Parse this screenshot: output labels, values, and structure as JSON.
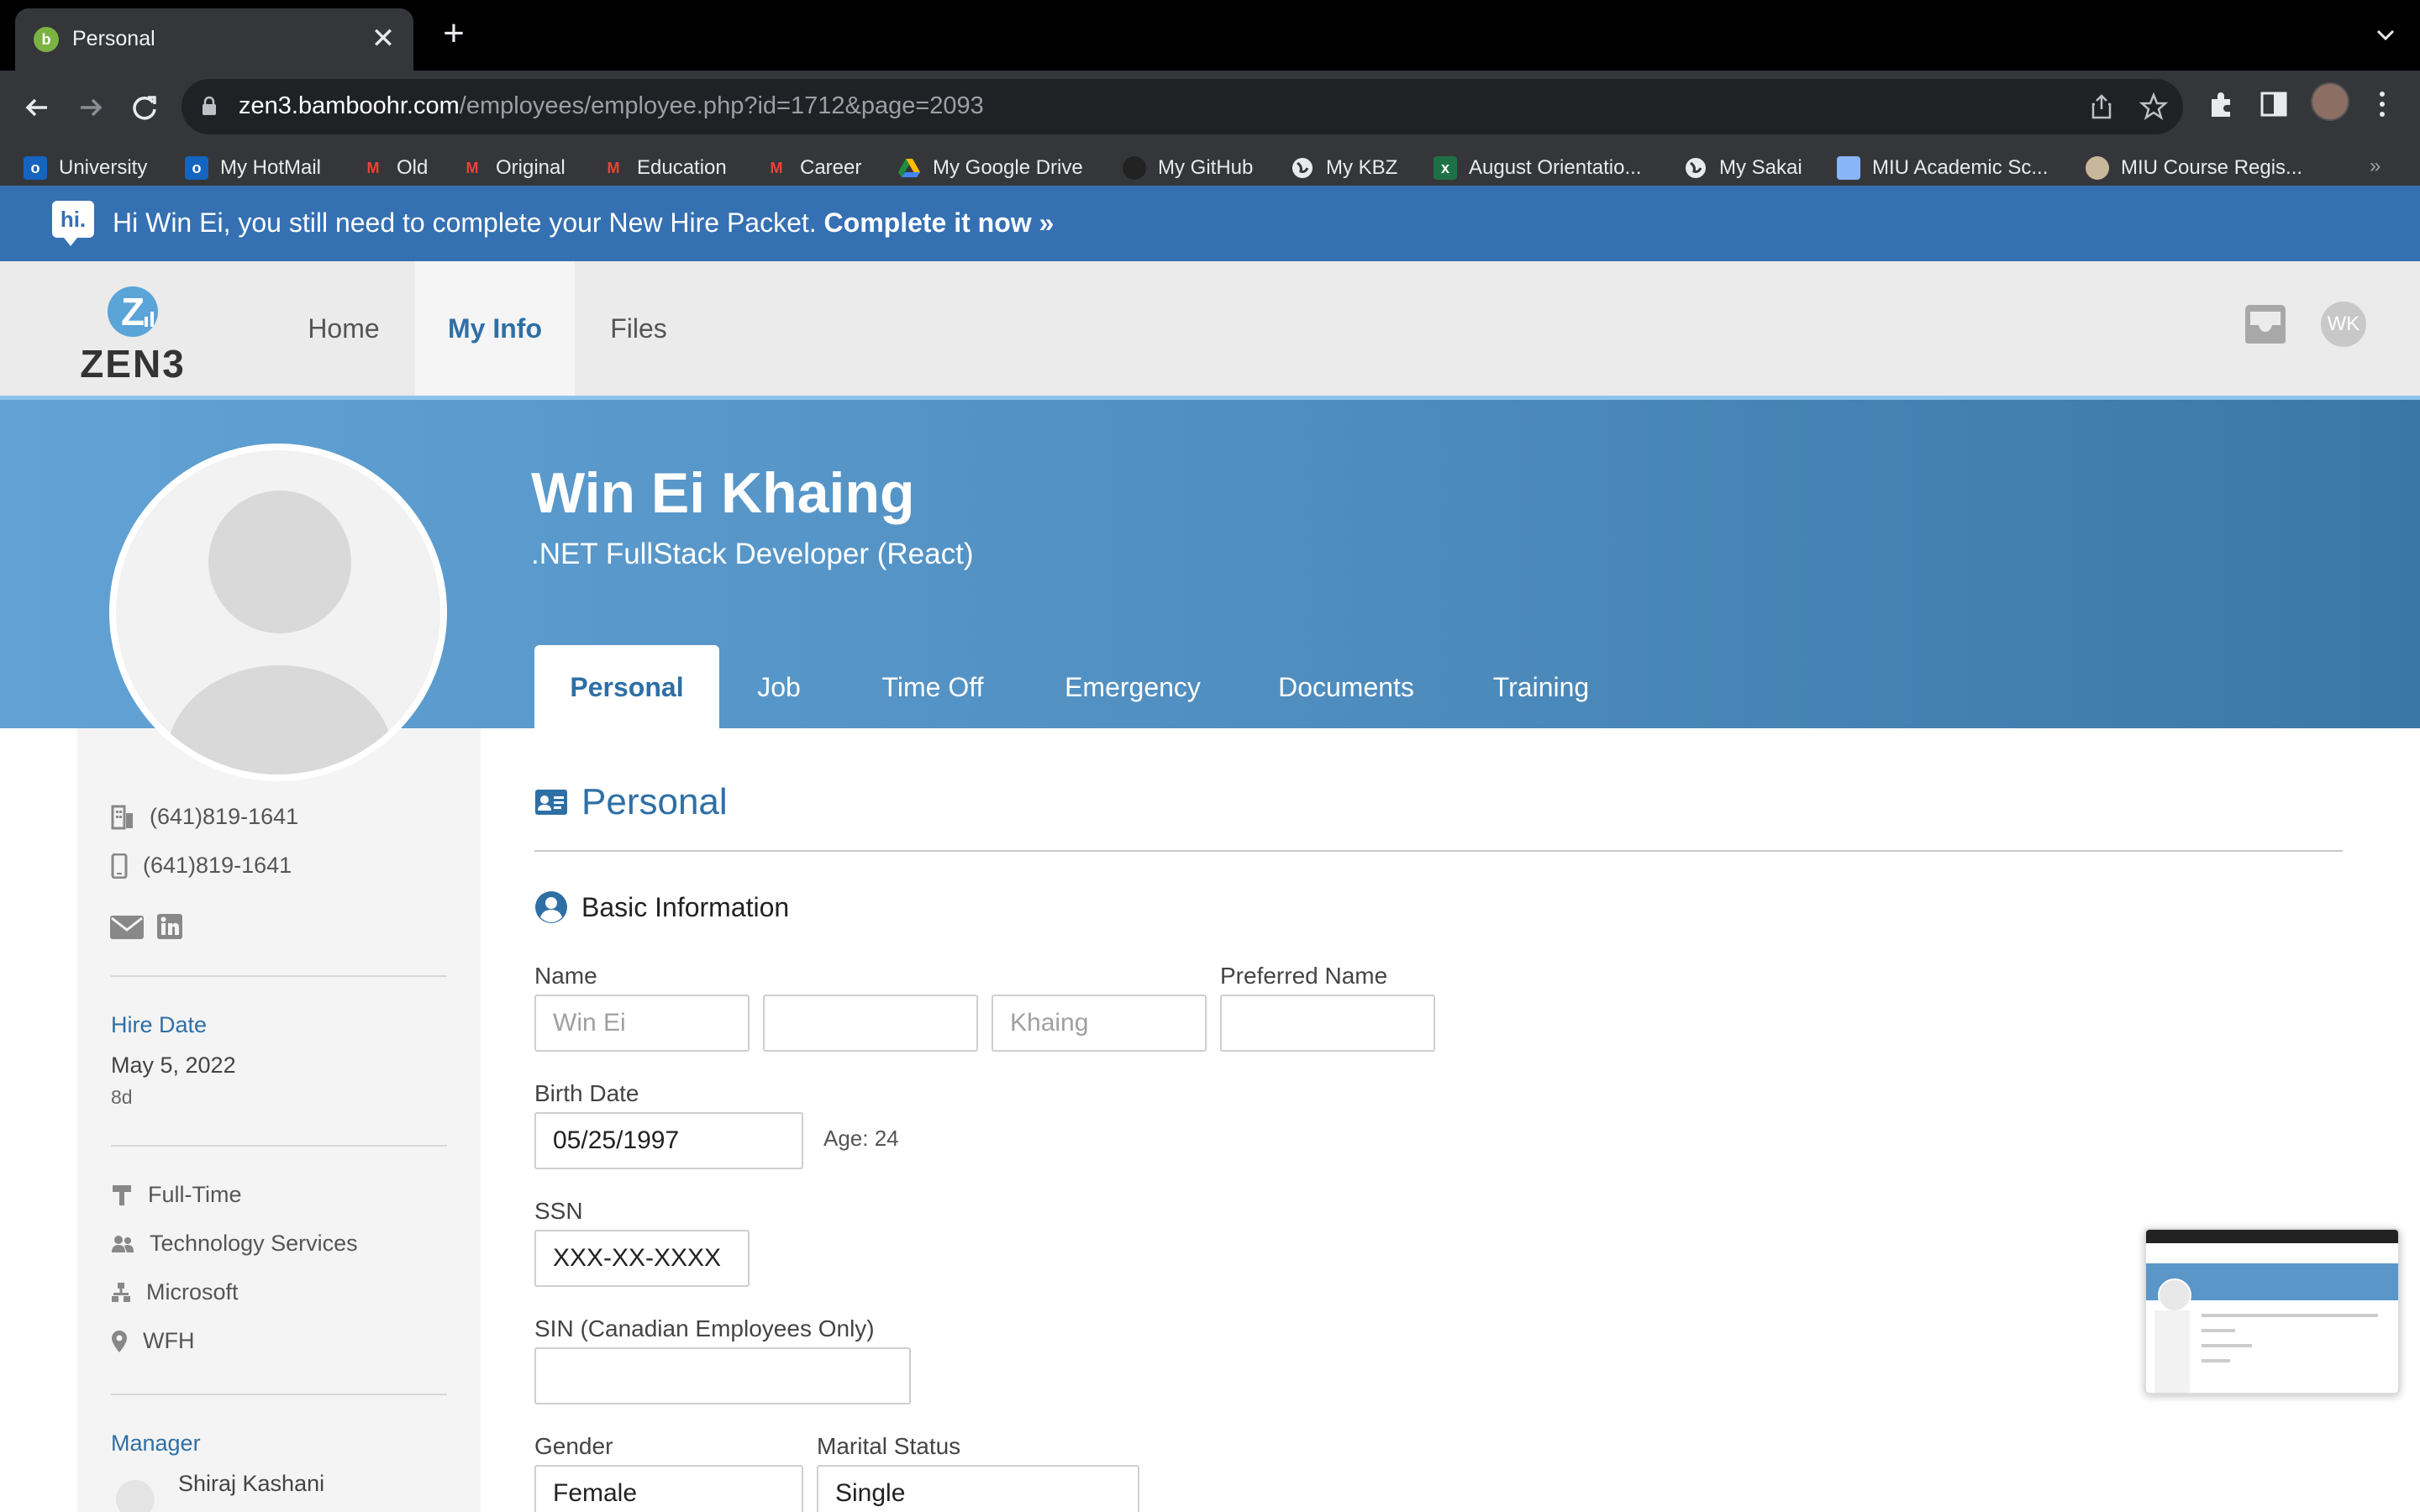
{
  "browser": {
    "tab_title": "Personal",
    "tab_close": "✕",
    "new_tab": "+",
    "url_host": "zen3.bamboohr.com",
    "url_path": "/employees/employee.php?id=1712&page=2093",
    "bookmarks": [
      {
        "label": "University",
        "icon": "outlook-icon"
      },
      {
        "label": "My HotMail",
        "icon": "outlook-icon"
      },
      {
        "label": "Old",
        "icon": "gmail-icon"
      },
      {
        "label": "Original",
        "icon": "gmail-icon"
      },
      {
        "label": "Education",
        "icon": "gmail-icon"
      },
      {
        "label": "Career",
        "icon": "gmail-icon"
      },
      {
        "label": "My Google Drive",
        "icon": "drive-icon"
      },
      {
        "label": "My GitHub",
        "icon": "github-icon"
      },
      {
        "label": "My KBZ",
        "icon": "globe-icon"
      },
      {
        "label": "August Orientatio...",
        "icon": "excel-icon"
      },
      {
        "label": "My Sakai",
        "icon": "globe-icon"
      },
      {
        "label": "MIU Academic Sc...",
        "icon": "page-icon"
      },
      {
        "label": "MIU Course Regis...",
        "icon": "circle-icon"
      }
    ],
    "bookmarks_more": "»"
  },
  "banner": {
    "badge": "hi.",
    "text": "Hi Win Ei, you still need to complete your New Hire Packet.",
    "link": "Complete it now »"
  },
  "nav": {
    "items": [
      "Home",
      "My Info",
      "Files"
    ],
    "active": "My Info",
    "user_initials": "WK"
  },
  "profile": {
    "name": "Win Ei Khaing",
    "title": ".NET FullStack Developer (React)",
    "tabs": [
      "Personal",
      "Job",
      "Time Off",
      "Emergency",
      "Documents",
      "Training"
    ],
    "active_tab": "Personal"
  },
  "sidebar": {
    "work_phone": "(641)819-1641",
    "mobile_phone": "(641)819-1641",
    "hire_date_label": "Hire Date",
    "hire_date": "May 5, 2022",
    "hire_tenure": "8d",
    "employment_type": "Full-Time",
    "department": "Technology Services",
    "division": "Microsoft",
    "location": "WFH",
    "manager_label": "Manager",
    "manager_name": "Shiraj Kashani"
  },
  "personal": {
    "section_title": "Personal",
    "basic_info_title": "Basic Information",
    "name_label": "Name",
    "first_name": "Win Ei",
    "middle_name": "",
    "last_name": "Khaing",
    "preferred_name_label": "Preferred Name",
    "preferred_name": "",
    "birth_date_label": "Birth Date",
    "birth_date": "05/25/1997",
    "age": "Age: 24",
    "ssn_label": "SSN",
    "ssn": "XXX-XX-XXXX",
    "sin_label": "SIN (Canadian Employees Only)",
    "sin": "",
    "gender_label": "Gender",
    "gender": "Female",
    "marital_label": "Marital Status",
    "marital": "Single"
  },
  "colors": {
    "brand_blue": "#2e6fa6",
    "banner_blue": "#3570b3",
    "header_gradient_start": "#62a2d4",
    "header_gradient_end": "#3b77a6"
  }
}
